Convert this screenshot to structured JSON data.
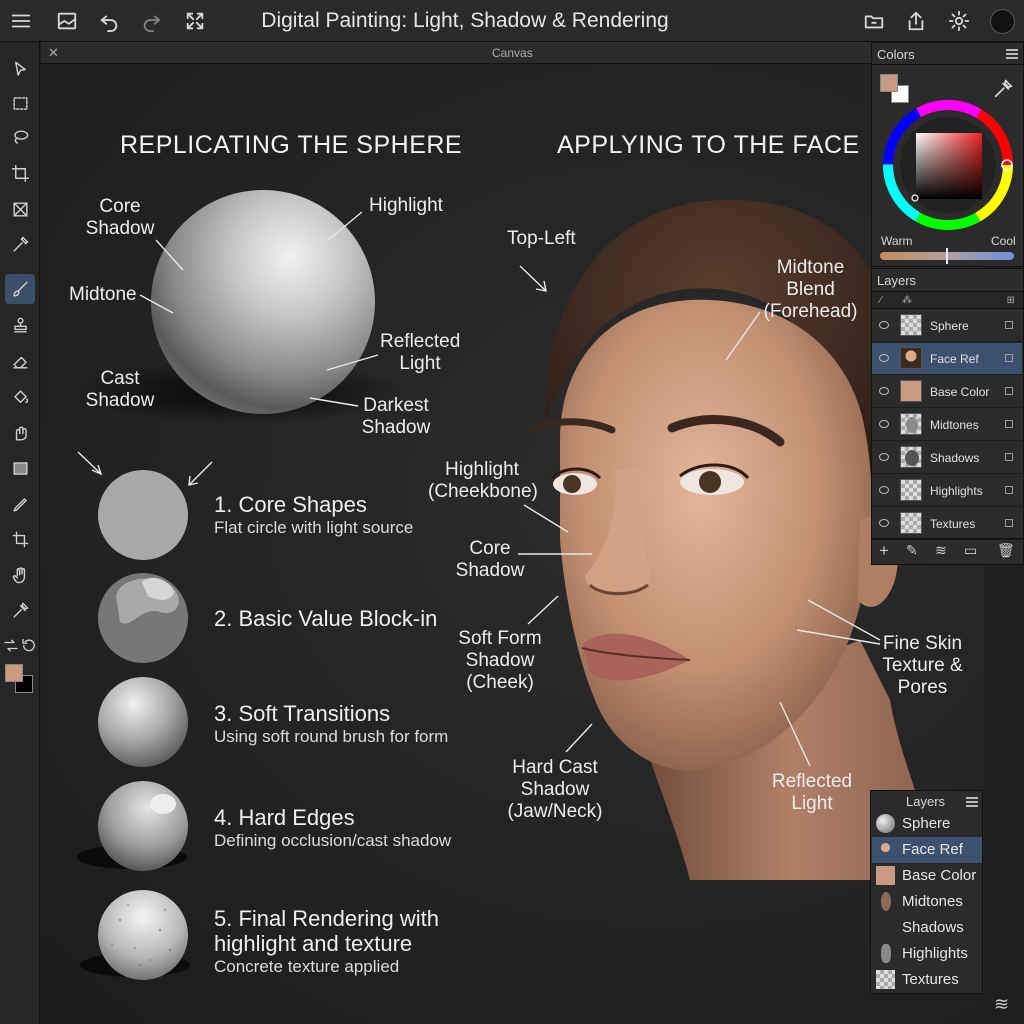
{
  "app": {
    "title": "Digital Painting: Light, Shadow & Rendering"
  },
  "topbar": {
    "icons": [
      "menu-icon",
      "image-icon",
      "undo-icon",
      "redo-icon",
      "expand-icon",
      "folder-icon",
      "share-icon",
      "gear-icon",
      "avatar"
    ]
  },
  "toolbar": {
    "tools": [
      "move-tool",
      "marquee-tool",
      "lasso-tool",
      "crop-tool",
      "frame-tool",
      "eyedropper-tool",
      "brush-tool",
      "stamp-tool",
      "eraser-tool",
      "fill-tool",
      "smudge-tool",
      "gradient-tool",
      "pen-tool",
      "transform-tool",
      "hand-tool",
      "picker-tool"
    ],
    "active": "brush-tool",
    "foreground_color": "#c89a82",
    "background_color": "#000000"
  },
  "canvas": {
    "tab_label": "Canvas",
    "left_heading": "REPLICATING THE SPHERE",
    "right_heading": "APPLYING TO THE FACE",
    "sphere_labels": {
      "core_shadow": "Core Shadow",
      "highlight": "Highlight",
      "midtone": "Midtone",
      "reflected_light": "Reflected Light",
      "cast_shadow": "Cast Shadow",
      "darkest_shadow": "Darkest Shadow"
    },
    "steps": [
      {
        "title": "1. Core Shapes",
        "subtitle": "Flat circle with light source"
      },
      {
        "title": "2. Basic Value Block-in",
        "subtitle": ""
      },
      {
        "title": "3. Soft Transitions",
        "subtitle": "Using soft round brush for form"
      },
      {
        "title": "4. Hard Edges",
        "subtitle": "Defining occlusion/cast shadow"
      },
      {
        "title": "5. Final Rendering with highlight and texture",
        "subtitle": "Concrete texture applied"
      }
    ],
    "face_labels": {
      "top_left": "Top-Left",
      "midtone_blend": "Midtone Blend (Forehead)",
      "highlight_cheekbone": "Highlight (Cheekbone)",
      "core_shadow": "Core Shadow",
      "soft_form_shadow": "Soft Form Shadow (Cheek)",
      "fine_skin": "Fine Skin Texture & Pores",
      "hard_cast_shadow": "Hard Cast Shadow (Jaw/Neck)",
      "reflected_light": "Reflected Light"
    }
  },
  "colors_panel": {
    "title": "Colors",
    "warm_label": "Warm",
    "cool_label": "Cool",
    "swatch_color": "#c89a82"
  },
  "layers_panel": {
    "title": "Layers",
    "layers": [
      {
        "name": "Sphere",
        "thumb": "checker",
        "selected": false
      },
      {
        "name": "Face Ref",
        "thumb": "face",
        "selected": true
      },
      {
        "name": "Base Color",
        "thumb": "#c89a82",
        "selected": false
      },
      {
        "name": "Midtones",
        "thumb": "checker",
        "selected": false
      },
      {
        "name": "Shadows",
        "thumb": "checker",
        "selected": false
      },
      {
        "name": "Highlights",
        "thumb": "checker",
        "selected": false
      },
      {
        "name": "Textures",
        "thumb": "checker",
        "selected": false
      }
    ],
    "footer_icons": [
      "add-layer-icon",
      "edit-layer-icon",
      "stack-icon",
      "folder-icon",
      "trash-icon"
    ]
  },
  "layers_panel_2": {
    "title": "Layers",
    "layers": [
      {
        "name": "Sphere",
        "selected": false
      },
      {
        "name": "Face Ref",
        "selected": true
      },
      {
        "name": "Base Color",
        "selected": false
      },
      {
        "name": "Midtones",
        "selected": false
      },
      {
        "name": "Shadows",
        "selected": false
      },
      {
        "name": "Highlights",
        "selected": false
      },
      {
        "name": "Textures",
        "selected": false
      }
    ]
  }
}
